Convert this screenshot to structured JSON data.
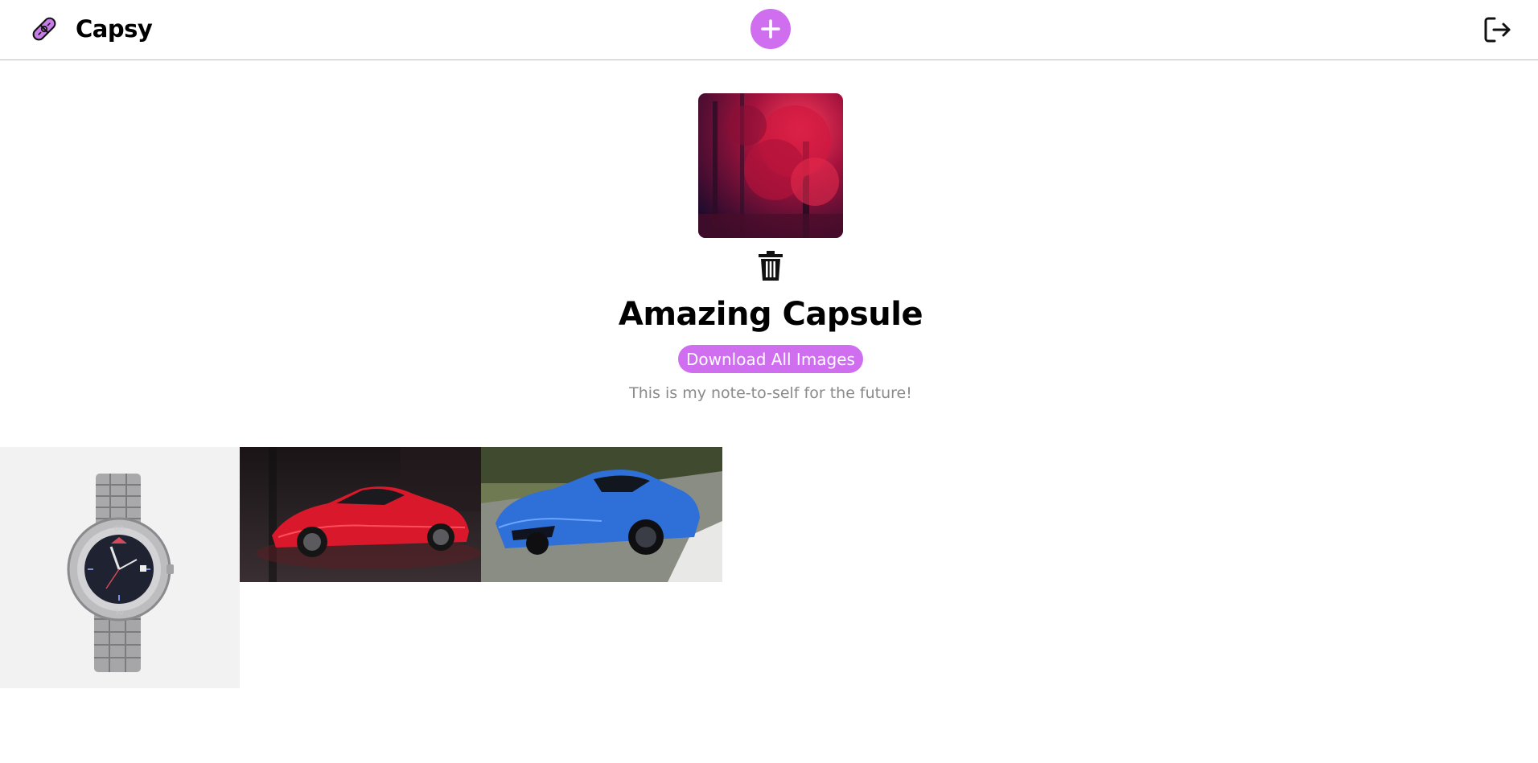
{
  "header": {
    "app_name": "Capsy",
    "logo_icon": "capsule-pill-icon",
    "add_icon": "plus-icon",
    "logout_icon": "logout-icon"
  },
  "capsule": {
    "title": "Amazing Capsule",
    "download_label": "Download All Images",
    "note": "This is my note-to-self for the future!",
    "delete_icon": "trash-icon",
    "cover_alt": "red autumn forest"
  },
  "gallery": {
    "items": [
      {
        "alt": "silver wristwatch"
      },
      {
        "alt": "red sports car"
      },
      {
        "alt": "blue sports car"
      }
    ]
  },
  "colors": {
    "accent": "#cf6ff0",
    "header_border": "#bcbcbc",
    "note_text": "#8a8a8a"
  }
}
